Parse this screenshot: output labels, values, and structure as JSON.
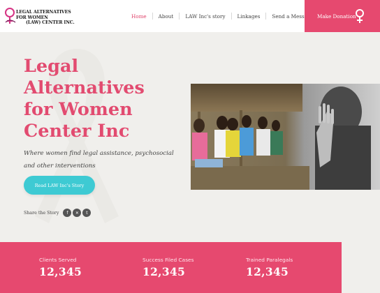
{
  "brand": {
    "logo_line1": "LEGAL ALTERNATIVES FOR WOMEN",
    "logo_line2": "(LAW) CENTER INC.",
    "accent": "#e6496f",
    "teal": "#3ecad3"
  },
  "nav": {
    "items": [
      {
        "label": "Home"
      },
      {
        "label": "About"
      },
      {
        "label": "LAW Inc's story"
      },
      {
        "label": "Linkages"
      },
      {
        "label": "Send a Message"
      }
    ],
    "donate_label": "Make Donation",
    "donate_icon": "female-symbol-icon"
  },
  "hero": {
    "title_lines": [
      "Legal",
      "Alternatives",
      "for Women",
      "Center Inc"
    ],
    "subtitle_line1": "Where women find legal assistance, psychosocial",
    "subtitle_line2": "and other interventions",
    "button_label": "Read LAW Inc's Story",
    "share_label": "Share the Story",
    "share_icons": [
      {
        "icon": "facebook-icon",
        "glyph": "f"
      },
      {
        "icon": "x-icon",
        "glyph": "✕"
      },
      {
        "icon": "tumblr-icon",
        "glyph": "t"
      }
    ]
  },
  "stats": [
    {
      "label": "Clients Served",
      "value": "12,345"
    },
    {
      "label": "Success Filed Cases",
      "value": "12,345"
    },
    {
      "label": "Trained Paralegals",
      "value": "12,345"
    }
  ]
}
